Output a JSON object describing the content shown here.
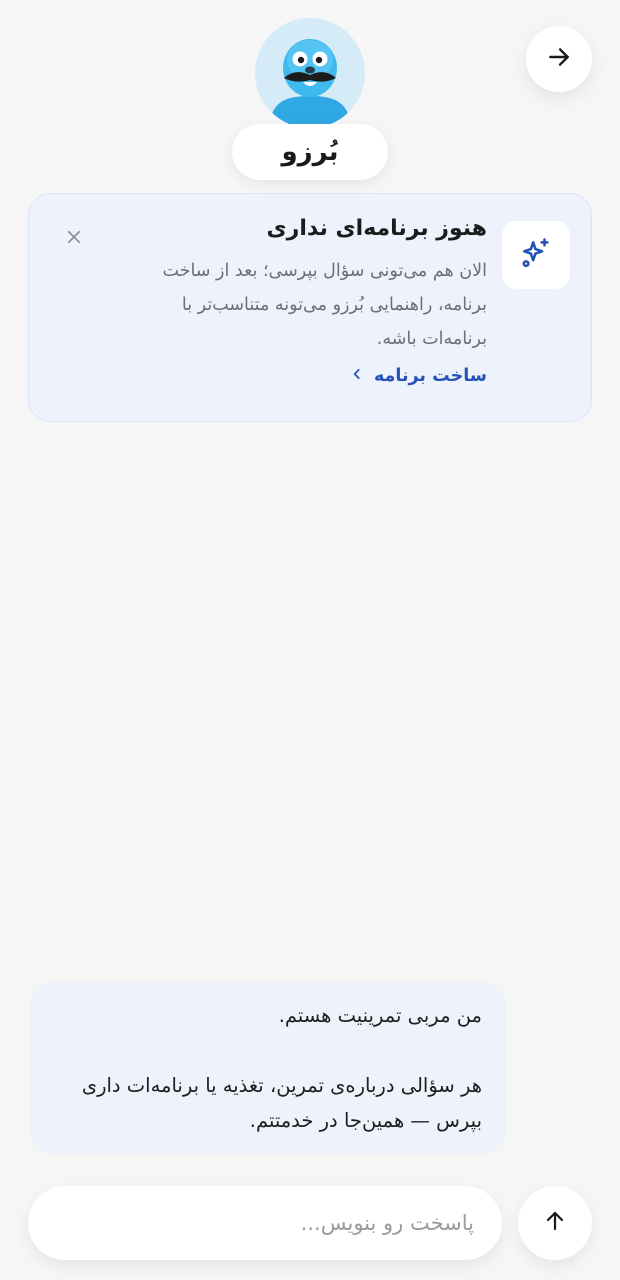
{
  "header": {
    "back_icon": "arrow-right-icon",
    "bot_name": "بُرزو",
    "avatar_icon": "blue-seal-mascot-avatar"
  },
  "plan_card": {
    "icon": "sparkles-icon",
    "close_icon": "close-icon",
    "title": "هنوز برنامه‌ای نداری",
    "body": "الان هم می‌تونی سؤال بپرسی؛ بعد از ساخت برنامه، راهنمایی بُرزو می‌تونه متناسب‌تر با برنامه‌ات باشه.",
    "link_label": "ساخت برنامه",
    "link_icon": "chevron-left-icon",
    "accent_color": "#2453b7",
    "background_color": "#edf2fc"
  },
  "chat": {
    "messages": [
      {
        "sender": "bot",
        "line_1": "من مربی تمرینیت هستم.",
        "line_2": "هر سؤالی درباره‌ی تمرین، تغذیه یا برنامه‌ات داری بپرس — همین‌جا در خدمتتم."
      }
    ]
  },
  "composer": {
    "value": "",
    "placeholder": "پاسخت رو بنویس...",
    "send_icon": "arrow-up-icon"
  }
}
